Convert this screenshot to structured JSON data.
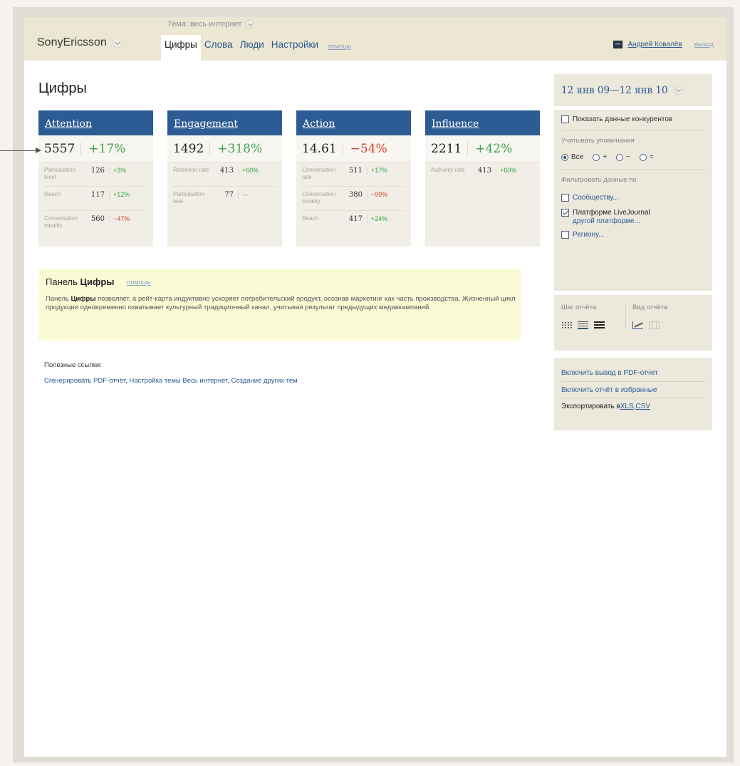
{
  "header": {
    "brand": "SonyEricsson",
    "topic_label": "Тема: весь интернет",
    "tabs": [
      {
        "label": "Цифры",
        "active": true
      },
      {
        "label": "Слова",
        "active": false
      },
      {
        "label": "Люди",
        "active": false
      },
      {
        "label": "Настройки",
        "active": false
      }
    ],
    "help": "помощь",
    "user_name": "Андрей Ковалёв",
    "logout": "выход"
  },
  "page_title": "Цифры",
  "cards": [
    {
      "title": "Attention",
      "value": "5557",
      "delta": "+17%",
      "delta_sign": "pos",
      "rows": [
        {
          "label": "Participation level",
          "value": "126",
          "delta": "+3%",
          "sign": "pos"
        },
        {
          "label": "Reach",
          "value": "117",
          "delta": "+12%",
          "sign": "pos"
        },
        {
          "label": "Conversation tonality",
          "value": "560",
          "delta": "−47%",
          "sign": "neg"
        }
      ]
    },
    {
      "title": "Engagement",
      "value": "1492",
      "delta": "+318%",
      "delta_sign": "pos",
      "rows": [
        {
          "label": "Retention rate",
          "value": "413",
          "delta": "+60%",
          "sign": "pos"
        },
        {
          "label": "Participation rate",
          "value": "77",
          "delta": "—",
          "sign": "neu"
        }
      ]
    },
    {
      "title": "Action",
      "value": "14.61",
      "delta": "−54%",
      "delta_sign": "neg",
      "rows": [
        {
          "label": "Conversation rate",
          "value": "511",
          "delta": "+17%",
          "sign": "pos"
        },
        {
          "label": "Conversation tonality",
          "value": "380",
          "delta": "−99%",
          "sign": "neg"
        },
        {
          "label": "Reach",
          "value": "417",
          "delta": "+24%",
          "sign": "pos"
        }
      ]
    },
    {
      "title": "Influence",
      "value": "2211",
      "delta": "+42%",
      "delta_sign": "pos",
      "rows": [
        {
          "label": "Authority rate",
          "value": "413",
          "delta": "+60%",
          "sign": "pos"
        }
      ]
    }
  ],
  "panel": {
    "title_prefix": "Панель",
    "title_bold": "Цифры",
    "help": "помощь",
    "text_prefix": "Панель",
    "text_bold": "Цифры",
    "text_body": " позволяет, а рейт-карта индуктивно ускоряет потребительский продукт, осознав маркетинг как часть производства. Жизненный цикл продукции одновременно охватывает культурный традиционный канал, учитывая результат предыдущих медиакампаний."
  },
  "links": {
    "title": "Полезные ссылки:",
    "items": [
      "Сгенерировать PDF-отчёт",
      "Настройка темы Весь интернет",
      "Создание других тем"
    ],
    "separator": ", "
  },
  "sidebar": {
    "date_range": "12 янв 09—12 янв 10",
    "show_competitors": "Показать данные конкурентов",
    "mentions_label": "Учитывать упоминания",
    "mentions_options": [
      {
        "label": "Все",
        "selected": true
      },
      {
        "label": "+",
        "selected": false
      },
      {
        "label": "−",
        "selected": false
      },
      {
        "label": "=",
        "selected": false
      }
    ],
    "filter_label": "Фильтровать данные по",
    "filter_community": "Сообществу...",
    "filter_platform": "Платформе LiveJournal",
    "filter_platform_other": "другой платформе...",
    "filter_region": "Региону...",
    "step_label": "Шаг отчёта",
    "view_label": "Вид отчёта",
    "export_pdf": "Включить вывод в PDF-отчет",
    "export_fav": "Включить отчёт в избранные",
    "export_prefix": "Экспортировать в ",
    "export_xls": "XLS",
    "export_sep": ", ",
    "export_csv": "CSV"
  }
}
